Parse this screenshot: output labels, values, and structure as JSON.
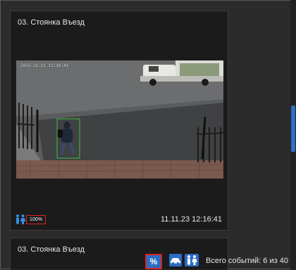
{
  "cards": [
    {
      "title": "03. Стоянка Въезд",
      "video_timestamp": "2023-11-11 12:16:41",
      "confidence": "100%",
      "datetime": "11.11.23 12:16:41"
    },
    {
      "title": "03. Стоянка Въезд"
    }
  ],
  "toolbar": {
    "percent_label": "%",
    "events_text": "Всего событий: 6 из 40"
  },
  "icons": {
    "people": "people-icon",
    "car": "car-icon"
  },
  "colors": {
    "accent": "#2b6cc4",
    "highlight": "#e02020",
    "detection_box": "#3fbf3f"
  }
}
